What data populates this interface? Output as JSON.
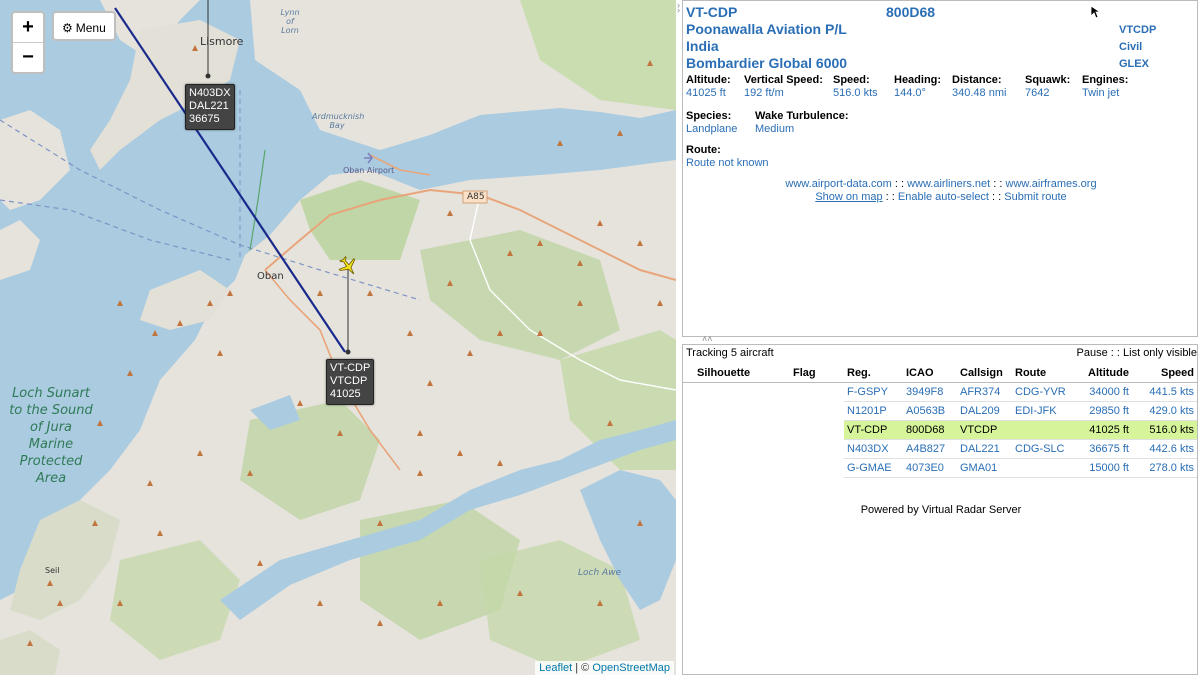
{
  "map": {
    "zoom_in": "+",
    "zoom_out": "−",
    "menu_label": "Menu",
    "place_labels": {
      "lismore": "Lismore",
      "lynn_of_lorn": "Lynn of Lorn",
      "ardmucknish_bay": "Ardmucknish Bay",
      "oban_airport": "Oban Airport",
      "oban": "Oban",
      "a85": "A85",
      "loch_sunart": "Loch Sunart to the Sound of Jura Marine Protected Area",
      "seil": "Seil",
      "loch_awe": "Loch Awe"
    },
    "aircraft_labels": [
      {
        "reg": "N403DX",
        "callsign": "DAL221",
        "altitude": "36675"
      },
      {
        "reg": "VT-CDP",
        "callsign": "VTCDP",
        "altitude": "41025"
      }
    ],
    "attribution": {
      "leaflet": "Leaflet",
      "sep": " | © ",
      "osm": "OpenStreetMap"
    }
  },
  "detail": {
    "registration": "VT-CDP",
    "icao": "800D68",
    "operator": "Poonawalla Aviation P/L",
    "operator_code": "VTCDP",
    "country": "India",
    "category": "Civil",
    "model": "Bombardier Global 6000",
    "model_code": "GLEX",
    "fields": [
      {
        "label": "Altitude:",
        "value": "41025 ft"
      },
      {
        "label": "Vertical Speed:",
        "value": "192 ft/m"
      },
      {
        "label": "Speed:",
        "value": "516.0 kts"
      },
      {
        "label": "Heading:",
        "value": "144.0°"
      },
      {
        "label": "Distance:",
        "value": "340.48 nmi"
      },
      {
        "label": "Squawk:",
        "value": "7642"
      },
      {
        "label": "Engines:",
        "value": "Twin jet"
      }
    ],
    "species_label": "Species:",
    "species_value": "Landplane",
    "wake_label": "Wake Turbulence:",
    "wake_value": "Medium",
    "route_label": "Route:",
    "route_value": "Route not known",
    "links": {
      "airport_data": "www.airport-data.com",
      "airliners": "www.airliners.net",
      "airframes": "www.airframes.org",
      "show_on_map": "Show on map",
      "auto_select": "Enable auto-select",
      "submit_route": "Submit route",
      "sep": " : : "
    }
  },
  "list": {
    "tracking_text": "Tracking 5 aircraft",
    "pause": "Pause",
    "sep": " : : ",
    "list_only_visible": "List only visible",
    "columns": [
      "Silhouette",
      "Flag",
      "Reg.",
      "ICAO",
      "Callsign",
      "Route",
      "Altitude",
      "Speed"
    ],
    "rows": [
      {
        "reg": "F-GSPY",
        "icao": "3949F8",
        "callsign": "AFR374",
        "route": "CDG-YVR",
        "altitude": "34000 ft",
        "speed": "441.5 kts"
      },
      {
        "reg": "N1201P",
        "icao": "A0563B",
        "callsign": "DAL209",
        "route": "EDI-JFK",
        "altitude": "29850 ft",
        "speed": "429.0 kts"
      },
      {
        "reg": "VT-CDP",
        "icao": "800D68",
        "callsign": "VTCDP",
        "route": "",
        "altitude": "41025 ft",
        "speed": "516.0 kts"
      },
      {
        "reg": "N403DX",
        "icao": "A4B827",
        "callsign": "DAL221",
        "route": "CDG-SLC",
        "altitude": "36675 ft",
        "speed": "442.6 kts"
      },
      {
        "reg": "G-GMAE",
        "icao": "4073E0",
        "callsign": "GMA01",
        "route": "",
        "altitude": "15000 ft",
        "speed": "278.0 kts"
      }
    ],
    "selected_index": 2,
    "powered_by": "Powered by Virtual Radar Server"
  },
  "colors": {
    "accent": "#2a6eb5",
    "selected_row": "#d6f59a",
    "track_line": "#1a2a8c",
    "selected_plane": "#f2e21c"
  }
}
